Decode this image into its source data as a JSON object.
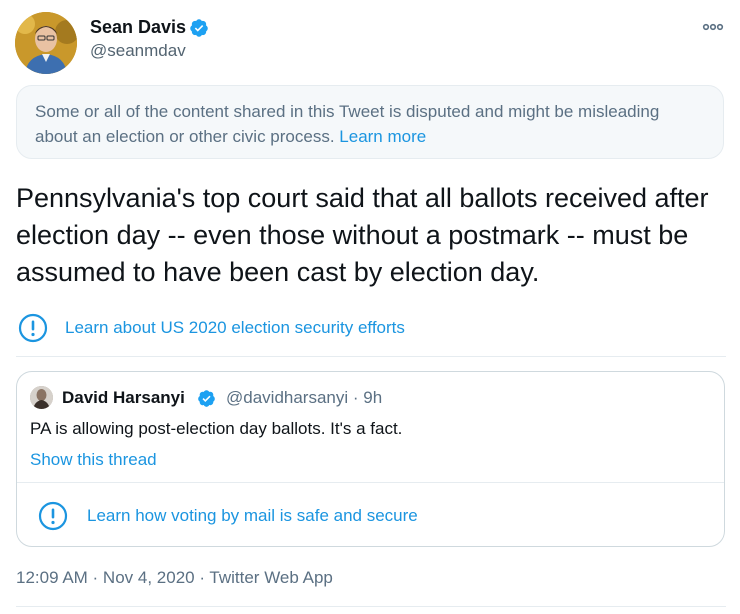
{
  "author": {
    "name": "Sean Davis",
    "handle": "@seanmdav",
    "avatar_icon": "profile-photo",
    "verified_icon": "verified-badge-icon"
  },
  "more_icon": "more-options-icon",
  "notice": {
    "text": "Some or all of the content shared in this Tweet is disputed and might be misleading about an election or other civic process. ",
    "link": "Learn more"
  },
  "tweet_text": "Pennsylvania's top court said that all ballots received after election day -- even those without a postmark -- must be assumed to have been cast by election day.",
  "election_info": {
    "icon": "info-exclamation-icon",
    "label": "Learn about US 2020 election security efforts"
  },
  "quote": {
    "name": "David Harsanyi",
    "handle": "@davidharsanyi",
    "separator": "·",
    "time": "9h",
    "text": "PA is allowing post-election day ballots. It's a fact.",
    "thread_link": "Show this thread",
    "info_icon": "info-exclamation-icon",
    "info_label": "Learn how voting by mail is safe and secure"
  },
  "timestamp": "12:09 AM · Nov 4, 2020 · Twitter Web App",
  "colors": {
    "link": "#1b95e0",
    "verified": "#1da1f2",
    "muted": "#5b7083",
    "notice_bg": "#f5f8fa"
  }
}
